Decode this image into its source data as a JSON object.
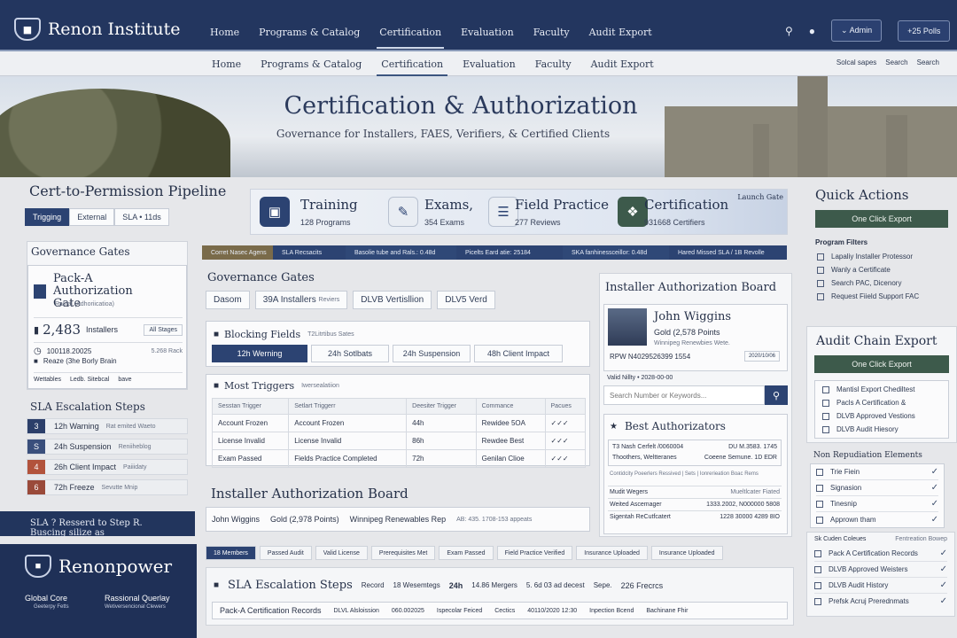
{
  "brand": {
    "name": "Renon Institute"
  },
  "topnav": [
    "Home",
    "Programs & Catalog",
    "Certification",
    "Evaluation",
    "Faculty",
    "Audit Export"
  ],
  "topnav_active": "Certification",
  "top_right": {
    "admin": "Admin",
    "polls": "+25 Polls"
  },
  "subnav": [
    "Home",
    "Programs & Catalog",
    "Certification",
    "Evaluation",
    "Faculty",
    "Audit Export"
  ],
  "subnav_tools": [
    "Solcal sapes",
    "Search",
    "Search"
  ],
  "hero": {
    "title": "Certification & Authorization",
    "subtitle": "Governance for Installers, FAES, Verifiers, & Certified Clients"
  },
  "pipeline": {
    "title": "Cert-to-Permission Pipeline",
    "tabs": [
      "Trigging",
      "External",
      "SLA • 11ds"
    ],
    "launch_gate": "Launch Gate",
    "stages": [
      {
        "name": "Training",
        "value": "128 Programs"
      },
      {
        "name": "Exams,",
        "value": "354 Exams"
      },
      {
        "name": "Field Practice",
        "value": "277 Reviews"
      },
      {
        "name": "Certification",
        "value": "931668 Certifiers"
      }
    ]
  },
  "left_gov": {
    "title": "Governance Gates",
    "card_title": "Pack-A Authorization Gate",
    "card_sub": "Rainal (Adhoriicatioa)",
    "count": "2,483",
    "count_label": "Installers",
    "count_tag": "All Stages",
    "date": "100118.20025",
    "date_tag": "5.268 Rack",
    "note": "Reaze (3he Borly Brain",
    "links": [
      "Wettables",
      "Ledb. Sitebcal",
      "bave"
    ]
  },
  "sla_left": {
    "title": "SLA Escalation Steps",
    "steps": [
      {
        "n": "3",
        "label": "12h Warning",
        "note": "Rat emited Waeto",
        "color": "#2c3f6a"
      },
      {
        "n": "S",
        "label": "24h Suspension",
        "note": "Reniiheblog",
        "color": "#3a4f7c"
      },
      {
        "n": "4",
        "label": "26h Client Impact",
        "note": "Paiiidaty",
        "color": "#b2533c"
      },
      {
        "n": "6",
        "label": "72h Freeze",
        "note": "Sevutte Mnip",
        "color": "#9a4a3a"
      }
    ],
    "bar": "SLA ?  Resserd to Step  R. Buscing silize as"
  },
  "renonpower": {
    "name": "Renonpower",
    "left": "Global Core",
    "left_sub": "Geeterpy Fetts",
    "right": "Rassional Querlay",
    "right_sub": "Wetiversencional Clewers"
  },
  "strip": [
    "Corret Nasec Agens",
    "SLA Recsacits",
    "Basolie tube and Rals.: 0.48d",
    "Picelts Eard atie: 25184",
    "SKA fanhinessceillor: 0.48d",
    "Hared Missed SLA / 1B Revolle"
  ],
  "gov_center": {
    "title": "Governance Gates",
    "chips": [
      "Dasom",
      "39A Installers",
      "Reviers",
      "DLVB Vertisllion",
      "DLV5 Verd"
    ],
    "blocking_title": "Blocking Fields",
    "blocking_tag": "T2Litrtibus Sates",
    "blocking_items": [
      "12h Werning",
      "24h Sotlbats",
      "24h Suspension",
      "48h Client Impact"
    ],
    "triggers_title": "Most Triggers",
    "triggers_tag": "Iwersealatiion",
    "table_headers": [
      "Sesstan Trigger",
      "Setlart Triggerr",
      "Deesiter Trigger",
      "Commance",
      "Pacues"
    ],
    "rows": [
      [
        "Account Frozen",
        "Account Frozen",
        "44h",
        "Rewidee 5OA",
        "✓✓✓"
      ],
      [
        "License Invalid",
        "License Invalid",
        "86h",
        "Rewdee Best",
        "✓✓✓"
      ],
      [
        "Exam Passed",
        "Fields Practice Completed",
        "72h",
        "Genilan Clioe",
        "✓✓✓"
      ]
    ]
  },
  "iab_center": {
    "title": "Installer Authorization Board",
    "row": [
      "John Wiggins",
      "Gold (2,978 Points)",
      "Winnipeg Renewables Rep",
      "AB: 435. 1708-153 appeats"
    ]
  },
  "badges": [
    "18 Members",
    "Passed Audit",
    "Valid License",
    "Prerequisites Met",
    "Exam Passed",
    "Field Practice Verified",
    "Insurance Uploaded",
    "Insurance Uploaded"
  ],
  "sla_bottom": {
    "title": "SLA Escalation Steps",
    "chips": [
      "Record",
      "18 Wesemtegs",
      "24h",
      "14.86 Mergers",
      "5. 6d 03 ad decest",
      "Sepe.",
      "226 Frecrcs"
    ],
    "row": [
      "Pack-A Certification Records",
      "DLVL Alsloission",
      "060.002025",
      "Ispecolar Feiced",
      "Cectics",
      "40110/2020 12:30",
      "Inpection Bcend",
      "Bachinane Fhir"
    ]
  },
  "iab_right": {
    "title": "Installer Authorization Board",
    "name": "John Wiggins",
    "tier": "Gold (2,578 Points",
    "org": "Winnipeg Renewbies Wete.",
    "rpw": "RPW N4029526399 1554",
    "rpw_tag": "2020/10/06",
    "validity": "Valid Nillty • 2028-00-00",
    "search_placeholder": "Search Number or Keywords...",
    "best_title": "Best Authorizators",
    "best_left": "T3 Nash Cerfelt /0060004",
    "best_right": "DU M.3583. 1745",
    "best_l2": "Thoothers, Weltteranes",
    "best_r2": "Coeene Semune. 1D EDR",
    "best_note": "Contidcity Poeerlers Ressived | Sets | Ionrerieation Boac Rems",
    "list": [
      [
        "Mudit Wegers",
        "Mueltlcater Fiated"
      ],
      [
        "Weited Ascemager",
        "1333.2002, N000000 5808"
      ],
      [
        "Sigentah ReCutfcatert",
        "1228 30000 4289 8IO"
      ]
    ]
  },
  "quick_actions": {
    "title": "Quick Actions",
    "button": "One Click Export",
    "filters_title": "Program Filters",
    "filters": [
      "Lapaliy Installer Protessor",
      "Wanly a Certificate",
      "Search PAC, Dicenory",
      "Request Fiield Support FAC"
    ]
  },
  "audit_chain": {
    "title": "Audit Chain Export",
    "button": "One Click Export",
    "items": [
      "Mantisl Export Chediltest",
      "Pacls A Certification &",
      "DLVB Approved Vestions",
      "DLVB Audit Hiesory"
    ]
  },
  "nonrep": {
    "title": "Non Repudiation Elements",
    "items": [
      "Trie Fiein",
      "Signasion",
      "Tinesnip",
      "Apprown tham"
    ]
  },
  "fcc": {
    "title": "Sk Cuden Coleues",
    "tag": "Fentreation Bowep",
    "items": [
      "Pack A Certification Records",
      "DLVB Approved Weisters",
      "DLVB Audit History",
      "Prefsk Acruj Prerednmats"
    ]
  }
}
